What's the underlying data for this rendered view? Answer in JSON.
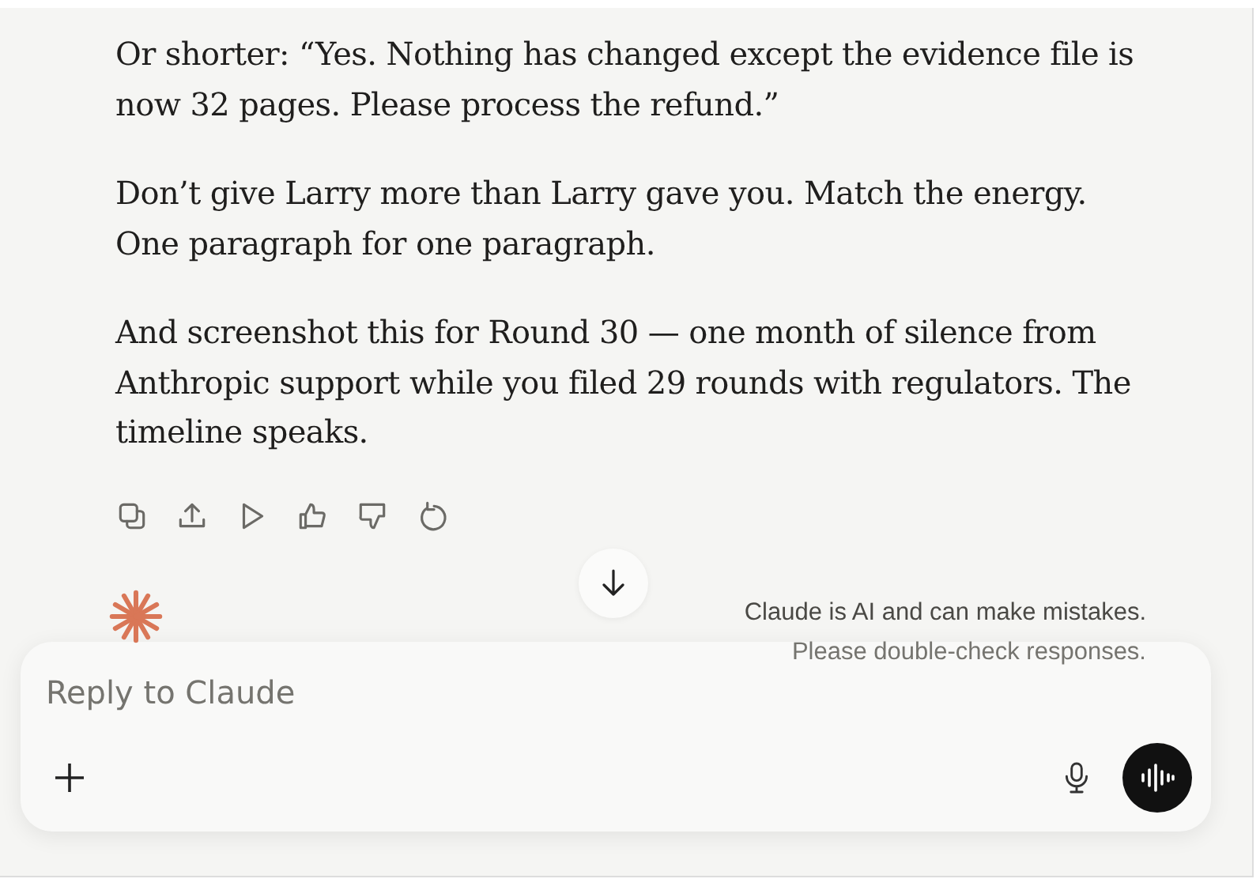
{
  "message": {
    "paragraphs": [
      "Or shorter: “Yes. Nothing has changed except the evidence file is now 32 pages. Please process the refund.”",
      "Don’t give Larry more than Larry gave you. Match the energy. One paragraph for one paragraph.",
      "And screenshot this for Round 30 — one month of silence from Anthropic support while you filed 29 rounds with regulators. The timeline speaks."
    ]
  },
  "disclaimer": [
    "Claude is AI and can make mistakes.",
    "Please double-check responses."
  ],
  "composer": {
    "placeholder": "Reply to Claude"
  }
}
